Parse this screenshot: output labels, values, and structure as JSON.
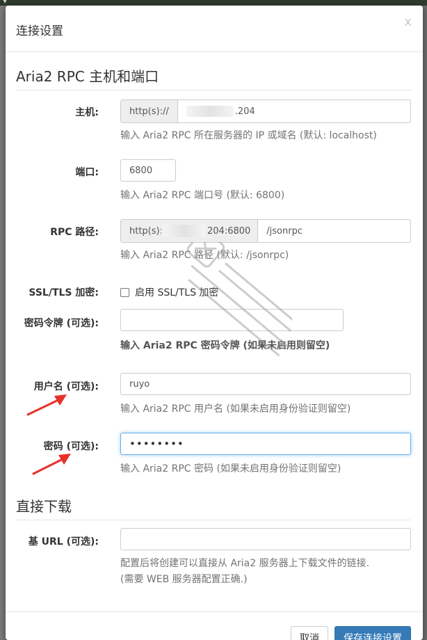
{
  "modal": {
    "title": "连接设置",
    "close_label": "x"
  },
  "section_rpc": {
    "title": "Aria2 RPC 主机和端口"
  },
  "host": {
    "label": "主机:",
    "prefix": "http(s)://",
    "value_suffix": ".204",
    "help": "输入 Aria2 RPC 所在服务器的 IP 或域名 (默认: localhost)"
  },
  "port": {
    "label": "端口:",
    "value": "6800",
    "help": "输入 Aria2 RPC 端口号 (默认: 6800)"
  },
  "rpc_path": {
    "label": "RPC 路径:",
    "prefix_start": "http(s)://",
    "prefix_end": "204:6800",
    "value": "/jsonrpc",
    "help": "输入 Aria2 RPC 路径 (默认: /jsonrpc)"
  },
  "ssl": {
    "label": "SSL/TLS 加密:",
    "checkbox_label": "启用 SSL/TLS 加密"
  },
  "token": {
    "label": "密码令牌 (可选):",
    "value": "",
    "help": "输入 Aria2 RPC 密码令牌 (如果未启用则留空)"
  },
  "username": {
    "label": "用户名 (可选):",
    "value": "ruyo",
    "help": "输入 Aria2 RPC 用户名 (如果未启用身份验证则留空)"
  },
  "password": {
    "label": "密码 (可选):",
    "value": "••••••••",
    "help": "输入 Aria2 RPC 密码 (如果未启用身份验证则留空)"
  },
  "section_direct": {
    "title": "直接下载"
  },
  "base_url": {
    "label": "基 URL (可选):",
    "value": "",
    "help_line1": "配置后将创建可以直接从 Aria2 服务器上下载文件的链接.",
    "help_line2": "(需要 WEB 服务器配置正确.)"
  },
  "footer": {
    "cancel_label": "取消",
    "save_label": "保存连接设置"
  },
  "colors": {
    "primary": "#337ab7",
    "focus_border": "#66afe9",
    "arrow": "#e8302a"
  }
}
